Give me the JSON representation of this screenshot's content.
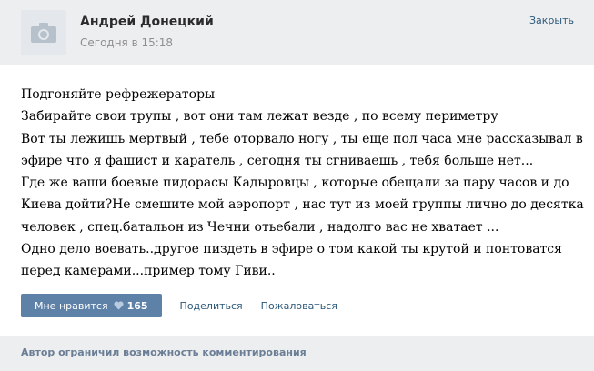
{
  "post": {
    "author": "Андрей Донецкий",
    "date": "Сегодня в 15:18",
    "close_label": "Закрыть",
    "lines": [
      "Подгоняйте рефрежераторы",
      "Забирайте свои трупы , вот они там лежат везде , по всему периметру",
      "Вот ты лежишь мертвый , тебе оторвало ногу , ты еще пол часа мне рассказывал в",
      "эфире что я фашист и каратель , сегодня ты сгниваешь , тебя больше нет...",
      "Где же ваши боевые пидорасы Кадыровцы , которые обещали за пару часов и до",
      "Киева дойти?Не смешите мой аэропорт , нас тут из моей группы лично до десятка",
      "человек , спец.батальон из Чечни отьебали , надолго вас не хватает ...",
      "Одно дело воевать..другое пиздеть в эфире о том какой ты крутой и понтоватся",
      "перед камерами...пример тому Гиви.."
    ]
  },
  "actions": {
    "like_label": "Мне нравится",
    "like_count": "165",
    "share_label": "Поделиться",
    "report_label": "Пожаловаться"
  },
  "footer": {
    "note": "Автор ограничил возможность комментирования"
  },
  "icons": {
    "avatar_placeholder": "camera-icon",
    "like": "heart-icon"
  },
  "colors": {
    "header_bg": "#edeef0",
    "link": "#2b587a",
    "button_bg": "#5e81a8",
    "footer_text": "#6a7e95"
  }
}
